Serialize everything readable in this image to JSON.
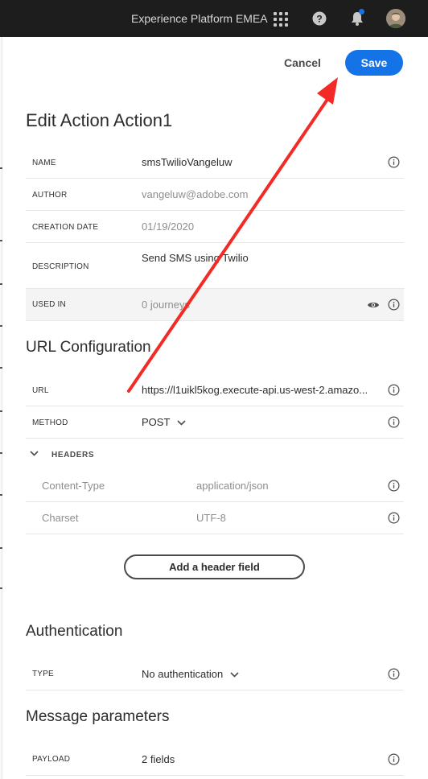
{
  "topbar": {
    "org_name": "Experience Platform EMEA",
    "icons": [
      "apps-grid-icon",
      "help-icon",
      "notification-bell-icon",
      "user-avatar"
    ],
    "notification_dot_color": "#1473e6"
  },
  "actions": {
    "cancel_label": "Cancel",
    "save_label": "Save",
    "accent_color": "#1473e6"
  },
  "page_title": "Edit Action Action1",
  "properties": {
    "name": {
      "label": "NAME",
      "value": "smsTwilioVangeluw"
    },
    "author": {
      "label": "AUTHOR",
      "value": "vangeluw@adobe.com"
    },
    "creation_date": {
      "label": "CREATION DATE",
      "value": "01/19/2020"
    },
    "description": {
      "label": "DESCRIPTION",
      "value": "Send SMS using Twilio"
    },
    "used_in": {
      "label": "USED IN",
      "value": "0 journeys"
    }
  },
  "url_config": {
    "title": "URL Configuration",
    "url": {
      "label": "URL",
      "value": "https://l1uikl5kog.execute-api.us-west-2.amazo..."
    },
    "method": {
      "label": "METHOD",
      "value": "POST"
    },
    "headers_label": "HEADERS",
    "headers": [
      {
        "key": "Content-Type",
        "value": "application/json"
      },
      {
        "key": "Charset",
        "value": "UTF-8"
      }
    ],
    "add_header_label": "Add a header field"
  },
  "authentication": {
    "title": "Authentication",
    "type": {
      "label": "TYPE",
      "value": "No authentication"
    }
  },
  "message_parameters": {
    "title": "Message parameters",
    "payload": {
      "label": "PAYLOAD",
      "value": "2 fields"
    }
  },
  "annotation": {
    "arrow_color": "#f22b27",
    "points_to": "save-button"
  }
}
